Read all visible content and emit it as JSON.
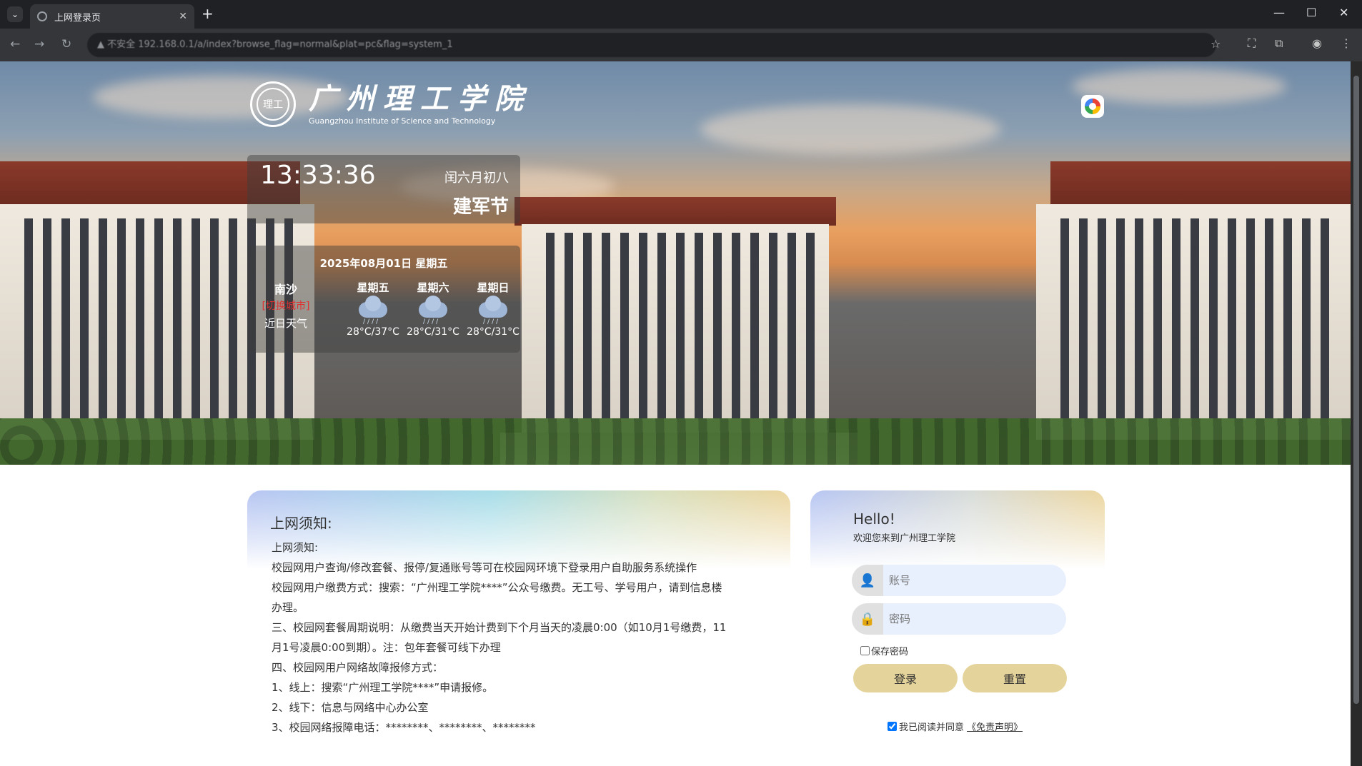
{
  "browser": {
    "tab_title": "上网登录页",
    "address": "▲ 不安全   192.168.0.1/a/index?browse_flag=normal&plat=pc&flag=system_1"
  },
  "hero": {
    "school_name_cn": "广州理工学院",
    "school_name_en": "Guangzhou Institute of Science and Technology",
    "seal_text": "理工",
    "clock": {
      "time": "13:33:36",
      "lunar_date": "闰六月初八",
      "holiday": "建军节"
    },
    "weather": {
      "date": "2025年08月01日 星期五",
      "city": "南沙",
      "change_city": "[切换城市]",
      "recent_label": "近日天气",
      "days": [
        {
          "name": "星期五",
          "icon": "rain-cloud-icon",
          "temp": "28°C/37°C"
        },
        {
          "name": "星期六",
          "icon": "rain-cloud-icon",
          "temp": "28°C/31°C"
        },
        {
          "name": "星期日",
          "icon": "rain-cloud-icon",
          "temp": "28°C/31°C"
        }
      ]
    }
  },
  "notice": {
    "title": "上网须知:",
    "lines": [
      "上网须知:",
      "校园网用户查询/修改套餐、报停/复通账号等可在校园网环境下登录用户自助服务系统操作",
      "校园网用户缴费方式：搜索：“广州理工学院****”公众号缴费。无工号、学号用户，请到信息楼",
      "办理。",
      "三、校园网套餐周期说明：从缴费当天开始计费到下个月当天的凌晨0:00（如10月1号缴费，11",
      "月1号凌晨0:00到期）。注：包年套餐可线下办理",
      "四、校园网用户网络故障报修方式：",
      "1、线上：搜索“广州理工学院****”申请报修。",
      "2、线下：信息与网络中心办公室",
      "3、校园网络报障电话：********、********、********"
    ]
  },
  "login": {
    "hello": "Hello!",
    "welcome": "欢迎您来到广州理工学院",
    "account_placeholder": "账号",
    "password_placeholder": "密码",
    "remember_label": "保存密码",
    "login_button": "登录",
    "reset_button": "重置",
    "agree_label": "我已阅读并同意",
    "disclaimer_link": "《免责声明》"
  },
  "colors": {
    "button_gold": "#e4d39a",
    "input_blue": "#e8f0fe",
    "city_switch_red": "#e03030"
  }
}
